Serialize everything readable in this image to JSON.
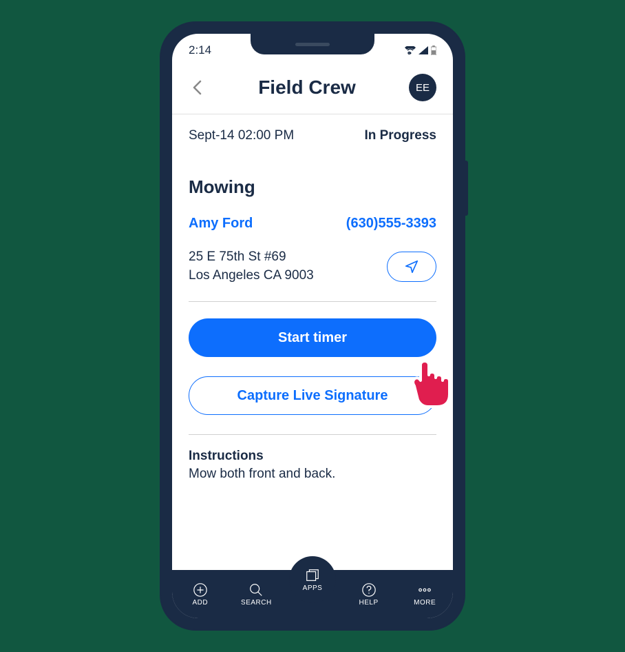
{
  "status_bar": {
    "time": "2:14"
  },
  "header": {
    "title": "Field Crew",
    "avatar_initials": "EE"
  },
  "job": {
    "datetime": "Sept-14 02:00 PM",
    "status": "In Progress",
    "title": "Mowing",
    "contact_name": "Amy Ford",
    "contact_phone": "(630)555-3393",
    "address_line1": "25 E 75th St #69",
    "address_line2": "Los Angeles CA 9003"
  },
  "actions": {
    "start_timer_label": "Start timer",
    "capture_signature_label": "Capture Live Signature"
  },
  "instructions": {
    "label": "Instructions",
    "text": "Mow both front and back."
  },
  "bottom_nav": {
    "add": "ADD",
    "search": "SEARCH",
    "apps": "APPS",
    "help": "HELP",
    "more": "MORE"
  }
}
